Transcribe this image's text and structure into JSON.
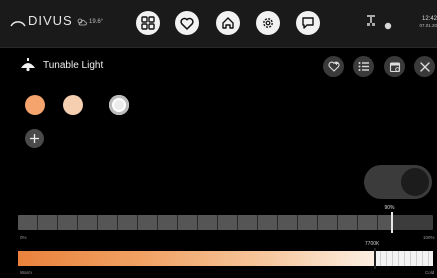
{
  "app": {
    "brand": "DIVUS",
    "weather_text": "19.6°",
    "clock_time": "12:42",
    "clock_date": "07.01.20"
  },
  "nav": [
    {
      "name": "grid-icon"
    },
    {
      "name": "heart-icon"
    },
    {
      "name": "home-icon"
    },
    {
      "name": "gear-icon"
    },
    {
      "name": "chat-icon"
    }
  ],
  "device": {
    "title": "Tunable Light",
    "icon": "ceiling-lamp-icon"
  },
  "tools": [
    "heart-plus-icon",
    "list-icon",
    "device-settings-icon",
    "close-icon"
  ],
  "presets": [
    {
      "color": "#f4a46c"
    },
    {
      "color": "#f6cfb0"
    },
    {
      "color": "#ececec"
    }
  ],
  "power": {
    "state": "on"
  },
  "dimmer": {
    "value_label": "90%",
    "value": 90,
    "min_label": "0%",
    "max_label": "100%"
  },
  "color_temp": {
    "value_label": "7700K",
    "position_fraction": 0.86,
    "min_label": "Warm",
    "max_label": "Cold"
  },
  "colors": {
    "accent_warm": "#e9823c",
    "topbar": "#1a1a1a"
  }
}
